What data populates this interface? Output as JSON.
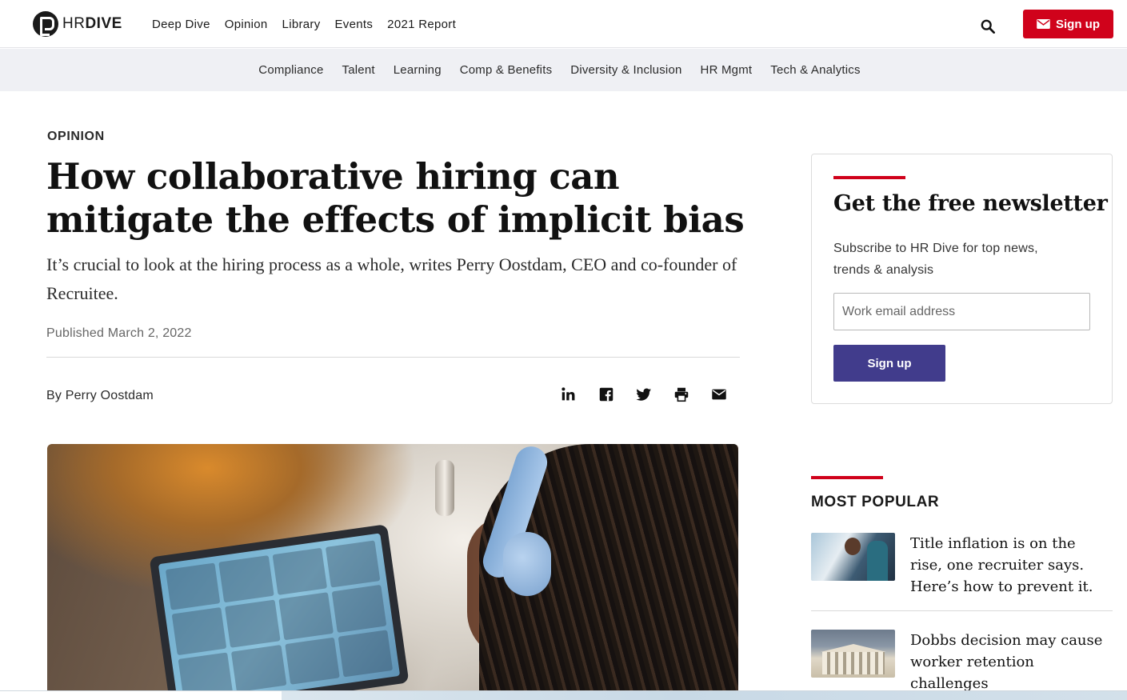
{
  "header": {
    "logo_prefix": "HR",
    "logo_suffix": "DIVE",
    "nav": [
      "Deep Dive",
      "Opinion",
      "Library",
      "Events",
      "2021 Report"
    ],
    "signup_label": "Sign up"
  },
  "subnav": [
    "Compliance",
    "Talent",
    "Learning",
    "Comp & Benefits",
    "Diversity & Inclusion",
    "HR Mgmt",
    "Tech & Analytics"
  ],
  "article": {
    "kicker": "OPINION",
    "headline": "How collaborative hiring can mitigate the effects of implicit bias",
    "dek": "It’s crucial to look at the hiring process as a whole, writes Perry Oostdam, CEO and co-founder of Recruitee.",
    "published": "Published March 2, 2022",
    "byline": "By Perry Oostdam",
    "share_icons": [
      "linkedin-icon",
      "facebook-icon",
      "twitter-icon",
      "print-icon",
      "email-icon"
    ]
  },
  "newsletter": {
    "title": "Get the free newsletter",
    "description": "Subscribe to HR Dive for top news, trends & analysis",
    "email_placeholder": "Work email address",
    "button_label": "Sign up"
  },
  "most_popular": {
    "heading": "MOST POPULAR",
    "items": [
      {
        "title": "Title inflation is on the rise, one recruiter says. Here’s how to prevent it."
      },
      {
        "title": "Dobbs decision may cause worker retention challenges"
      }
    ]
  },
  "colors": {
    "brand_red": "#d0021b",
    "button_purple": "#413c8c",
    "subnav_bg": "#eff0f4"
  }
}
